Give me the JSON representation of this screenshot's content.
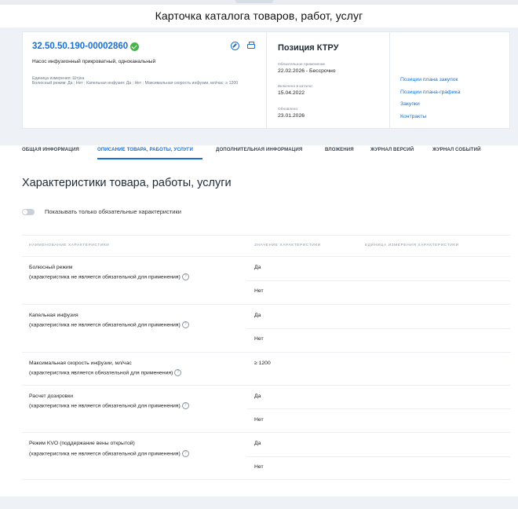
{
  "page": {
    "title": "Карточка каталога товаров, работ, услуг"
  },
  "card": {
    "code": "32.50.50.190-00002860",
    "name": "Насос инфузионный прикроватный, одноканальный",
    "unit_line": "Единица измерения: Штука",
    "description": "Болюсный режим: Да ; Нет ; Капельная инфузия: Да ; Нет ; Максимальная скорость инфузии, мл/час: ≥ 1200",
    "ktru": {
      "title": "Позиция КТРУ",
      "mandatory_label": "Обязательное применение",
      "mandatory_value": "22.02.2026 - Бессрочно",
      "included_label": "Включено в каталог",
      "included_value": "15.04.2022",
      "updated_label": "Обновлено",
      "updated_value": "23.01.2026"
    },
    "links": [
      "Позиции плана закупок",
      "Позиции плана-графика",
      "Закупки",
      "Контракты"
    ]
  },
  "tabs": [
    {
      "label": "ОБЩАЯ ИНФОРМАЦИЯ",
      "active": false
    },
    {
      "label": "ОПИСАНИЕ ТОВАРА, РАБОТЫ, УСЛУГИ",
      "active": true
    },
    {
      "label": "ДОПОЛНИТЕЛЬНАЯ ИНФОРМАЦИЯ",
      "active": false
    },
    {
      "label": "ВЛОЖЕНИЯ",
      "active": false
    },
    {
      "label": "ЖУРНАЛ ВЕРСИЙ",
      "active": false
    },
    {
      "label": "ЖУРНАЛ СОБЫТИЙ",
      "active": false
    }
  ],
  "section": {
    "title": "Характеристики товара, работы, услуги",
    "toggle_label": "Показывать только обязательные характеристики",
    "columns": [
      "НАИМЕНОВАНИЕ ХАРАКТЕРИСТИКИ",
      "ЗНАЧЕНИЕ ХАРАКТЕРИСТИКИ",
      "ЕДИНИЦА ИЗМЕРЕНИЯ ХАРАКТЕРИСТИКИ"
    ],
    "rows": [
      {
        "name": "Болюсный режим",
        "note": "(характеристика не является обязательной для применения)",
        "values": [
          "Да",
          "Нет"
        ]
      },
      {
        "name": "Капельная инфузия",
        "note": "(характеристика не является обязательной для применения)",
        "values": [
          "Да",
          "Нет"
        ]
      },
      {
        "name": "Максимальная скорость инфузии, мл/час",
        "note": "(характеристика является обязательной для применения)",
        "values": [
          "≥ 1200"
        ]
      },
      {
        "name": "Расчет дозировки",
        "note": "(характеристика не является обязательной для применения)",
        "values": [
          "Да",
          "Нет"
        ]
      },
      {
        "name": "Режим KVO (поддержание вены открытой)",
        "note": "(характеристика не является обязательной для применения)",
        "values": [
          "Да",
          "Нет"
        ]
      }
    ]
  },
  "colors": {
    "accent": "#1a6fd6",
    "success": "#49b44a",
    "background_panel": "#eef1f5"
  },
  "icons": {
    "verified": "check-circle-icon",
    "view": "compass-icon",
    "print": "printer-icon",
    "help": "question-circle-icon"
  }
}
